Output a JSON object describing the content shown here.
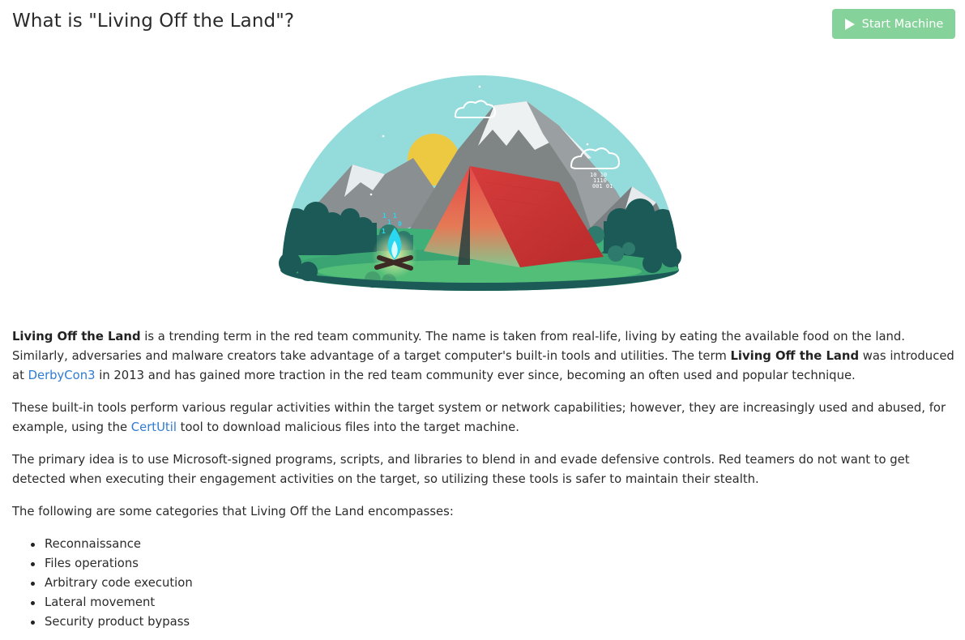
{
  "header": {
    "title": "What is \"Living Off the Land\"?",
    "start_button_label": "Start Machine",
    "start_button_color": "#85d39a"
  },
  "hero": {
    "alt": "Camping tent with campfire illustration",
    "fire_digits": [
      "1",
      "1",
      "1",
      "0",
      "1"
    ],
    "cloud_digits": [
      "10 10",
      "1110",
      "001 01"
    ]
  },
  "paragraph1": {
    "term1": "Living Off the Land",
    "text1": " is a trending term in the red team community. The name is taken from real-life, living by eating the available food on the land. Similarly, adversaries and malware creators take advantage of a target computer's built-in tools and utilities. The term ",
    "term2": "Living Off the Land",
    "text2": " was introduced at ",
    "link": "DerbyCon3",
    "text3": " in 2013 and has gained more traction in the red team community ever since, becoming an often used and popular technique."
  },
  "paragraph2": {
    "text1": "These built-in tools perform various regular activities within the target system or network capabilities; however, they are increasingly used and abused, for example, using the ",
    "link": "CertUtil",
    "text2": " tool to download malicious files into the target machine."
  },
  "paragraph3": "The primary idea is to use Microsoft-signed programs, scripts, and libraries to blend in and evade defensive controls. Red teamers do not want to get detected when executing their engagement activities on the target, so utilizing these tools is safer to maintain their stealth.",
  "paragraph4": "The following are some categories that Living Off the Land encompasses:",
  "categories": [
    "Reconnaissance",
    "Files operations",
    "Arbitrary code execution",
    "Lateral movement",
    "Security product bypass"
  ],
  "link_color": "#2f7bd1"
}
